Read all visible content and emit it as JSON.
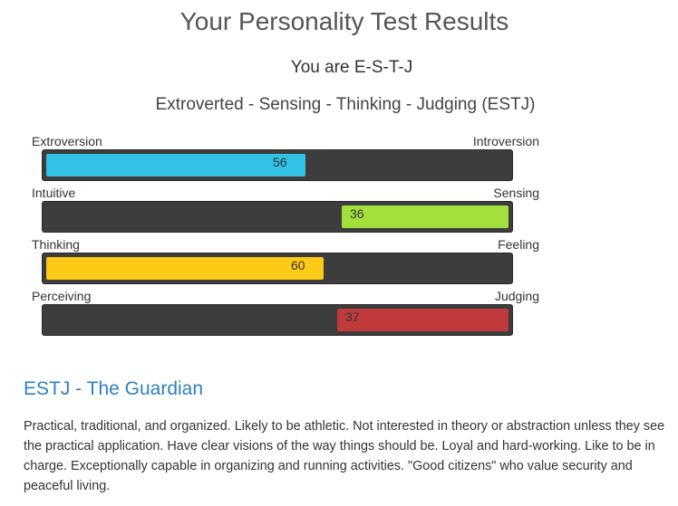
{
  "page": {
    "title": "Your Personality Test Results",
    "you_are": "You are E-S-T-J",
    "type_full": "Extroverted - Sensing - Thinking - Judging (ESTJ)"
  },
  "scales": [
    {
      "left_label": "Extroversion",
      "right_label": "Introversion",
      "value": 56,
      "side": "left",
      "color": "#31c2e6"
    },
    {
      "left_label": "Intuitive",
      "right_label": "Sensing",
      "value": 36,
      "side": "right",
      "color": "#a2e03b"
    },
    {
      "left_label": "Thinking",
      "right_label": "Feeling",
      "value": 60,
      "side": "left",
      "color": "#fdca16"
    },
    {
      "left_label": "Perceiving",
      "right_label": "Judging",
      "value": 37,
      "side": "right",
      "color": "#c0393b"
    }
  ],
  "result": {
    "heading": "ESTJ - The Guardian",
    "description": "Practical, traditional, and organized. Likely to be athletic. Not interested in theory or abstraction unless they see the practical application. Have clear visions of the way things should be. Loyal and hard-working. Like to be in charge. Exceptionally capable in organizing and running activities. \"Good citizens\" who value security and peaceful living."
  }
}
